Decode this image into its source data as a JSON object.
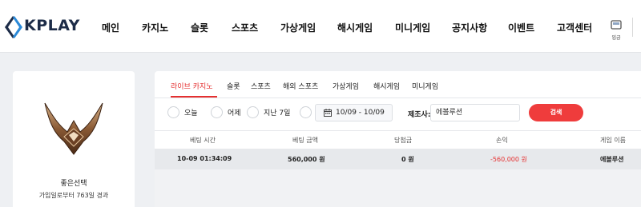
{
  "header": {
    "logo": "KPLAY",
    "nav": [
      {
        "label": "메인"
      },
      {
        "label": "카지노"
      },
      {
        "label": "슬롯"
      },
      {
        "label": "스포츠"
      },
      {
        "label": "가상게임"
      },
      {
        "label": "해시게임"
      },
      {
        "label": "미니게임"
      },
      {
        "label": "공지사항"
      },
      {
        "label": "이벤트"
      },
      {
        "label": "고객센터"
      }
    ],
    "deposit_label": "입금"
  },
  "profile": {
    "name": "좋은선택",
    "since": "가입일로부터 763일 경과"
  },
  "panel": {
    "tabs": [
      {
        "label": "라이브 카지노",
        "active": true
      },
      {
        "label": "슬롯"
      },
      {
        "label": "스포츠"
      },
      {
        "label": "해외 스포츠"
      },
      {
        "label": "가상게임"
      },
      {
        "label": "해시게임"
      },
      {
        "label": "미니게임"
      }
    ],
    "filters": {
      "radios": [
        {
          "label": "오늘"
        },
        {
          "label": "어제"
        },
        {
          "label": "지난 7일"
        },
        {
          "label": ""
        }
      ],
      "date_range": "10/09 - 10/09",
      "maker_label": "제조사:",
      "maker_value": "에볼루션",
      "search_label": "검색"
    },
    "table": {
      "columns": [
        "베팅 시간",
        "베팅 금액",
        "당첨금",
        "손익",
        "게임 이름"
      ],
      "rows": [
        {
          "time": "10-09 01:34:09",
          "bet": "560,000 원",
          "win": "0 원",
          "pl": "-560,000 원",
          "game": "에볼루션"
        }
      ]
    }
  },
  "colors": {
    "accent": "#e53030",
    "button": "#ef3c3c",
    "logo_blue": "#2a89d8",
    "logo_navy": "#1d2c48"
  }
}
